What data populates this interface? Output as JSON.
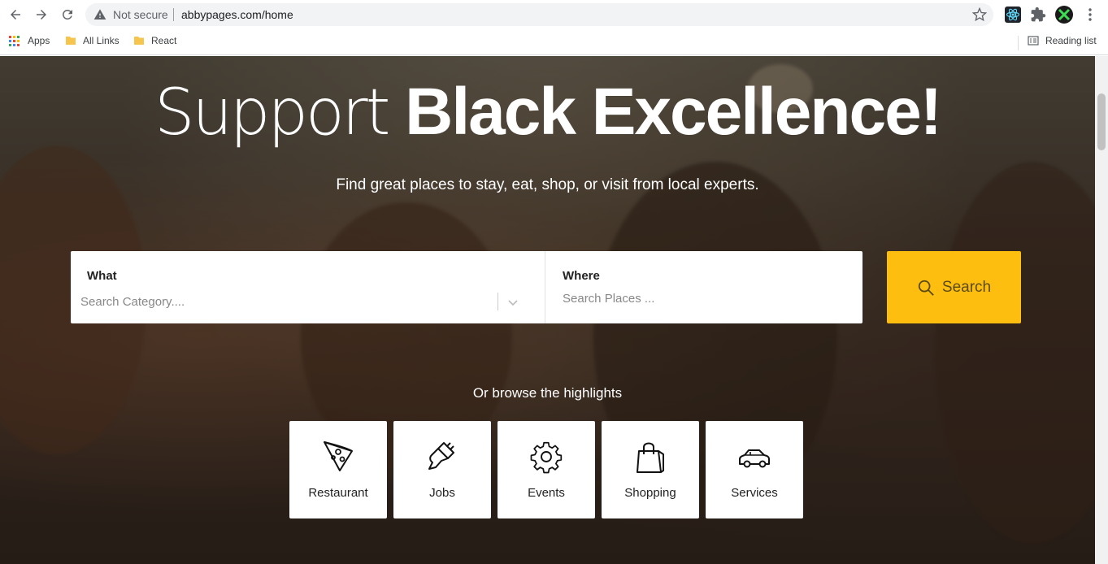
{
  "browser": {
    "security_label": "Not secure",
    "url": "abbypages.com/home",
    "bookmarks": [
      {
        "label": "Apps",
        "icon": "apps-grid-icon"
      },
      {
        "label": "All Links",
        "icon": "folder-icon"
      },
      {
        "label": "React",
        "icon": "folder-icon"
      }
    ],
    "reading_list_label": "Reading list"
  },
  "hero": {
    "title_light": "Support",
    "title_bold": "Black Excellence!",
    "subtitle": "Find great places to stay, eat, shop, or visit from local experts."
  },
  "search": {
    "what_label": "What",
    "what_placeholder": "Search Category....",
    "where_label": "Where",
    "where_placeholder": "Search Places ...",
    "button_label": "Search"
  },
  "browse": {
    "heading": "Or browse the highlights",
    "categories": [
      {
        "label": "Restaurant",
        "icon": "pizza-slice-icon"
      },
      {
        "label": "Jobs",
        "icon": "paint-brush-icon"
      },
      {
        "label": "Events",
        "icon": "gear-icon"
      },
      {
        "label": "Shopping",
        "icon": "shopping-bag-icon"
      },
      {
        "label": "Services",
        "icon": "car-icon"
      }
    ]
  },
  "colors": {
    "accent": "#fdbe10",
    "bookmark_folder": "#f5c54e"
  }
}
